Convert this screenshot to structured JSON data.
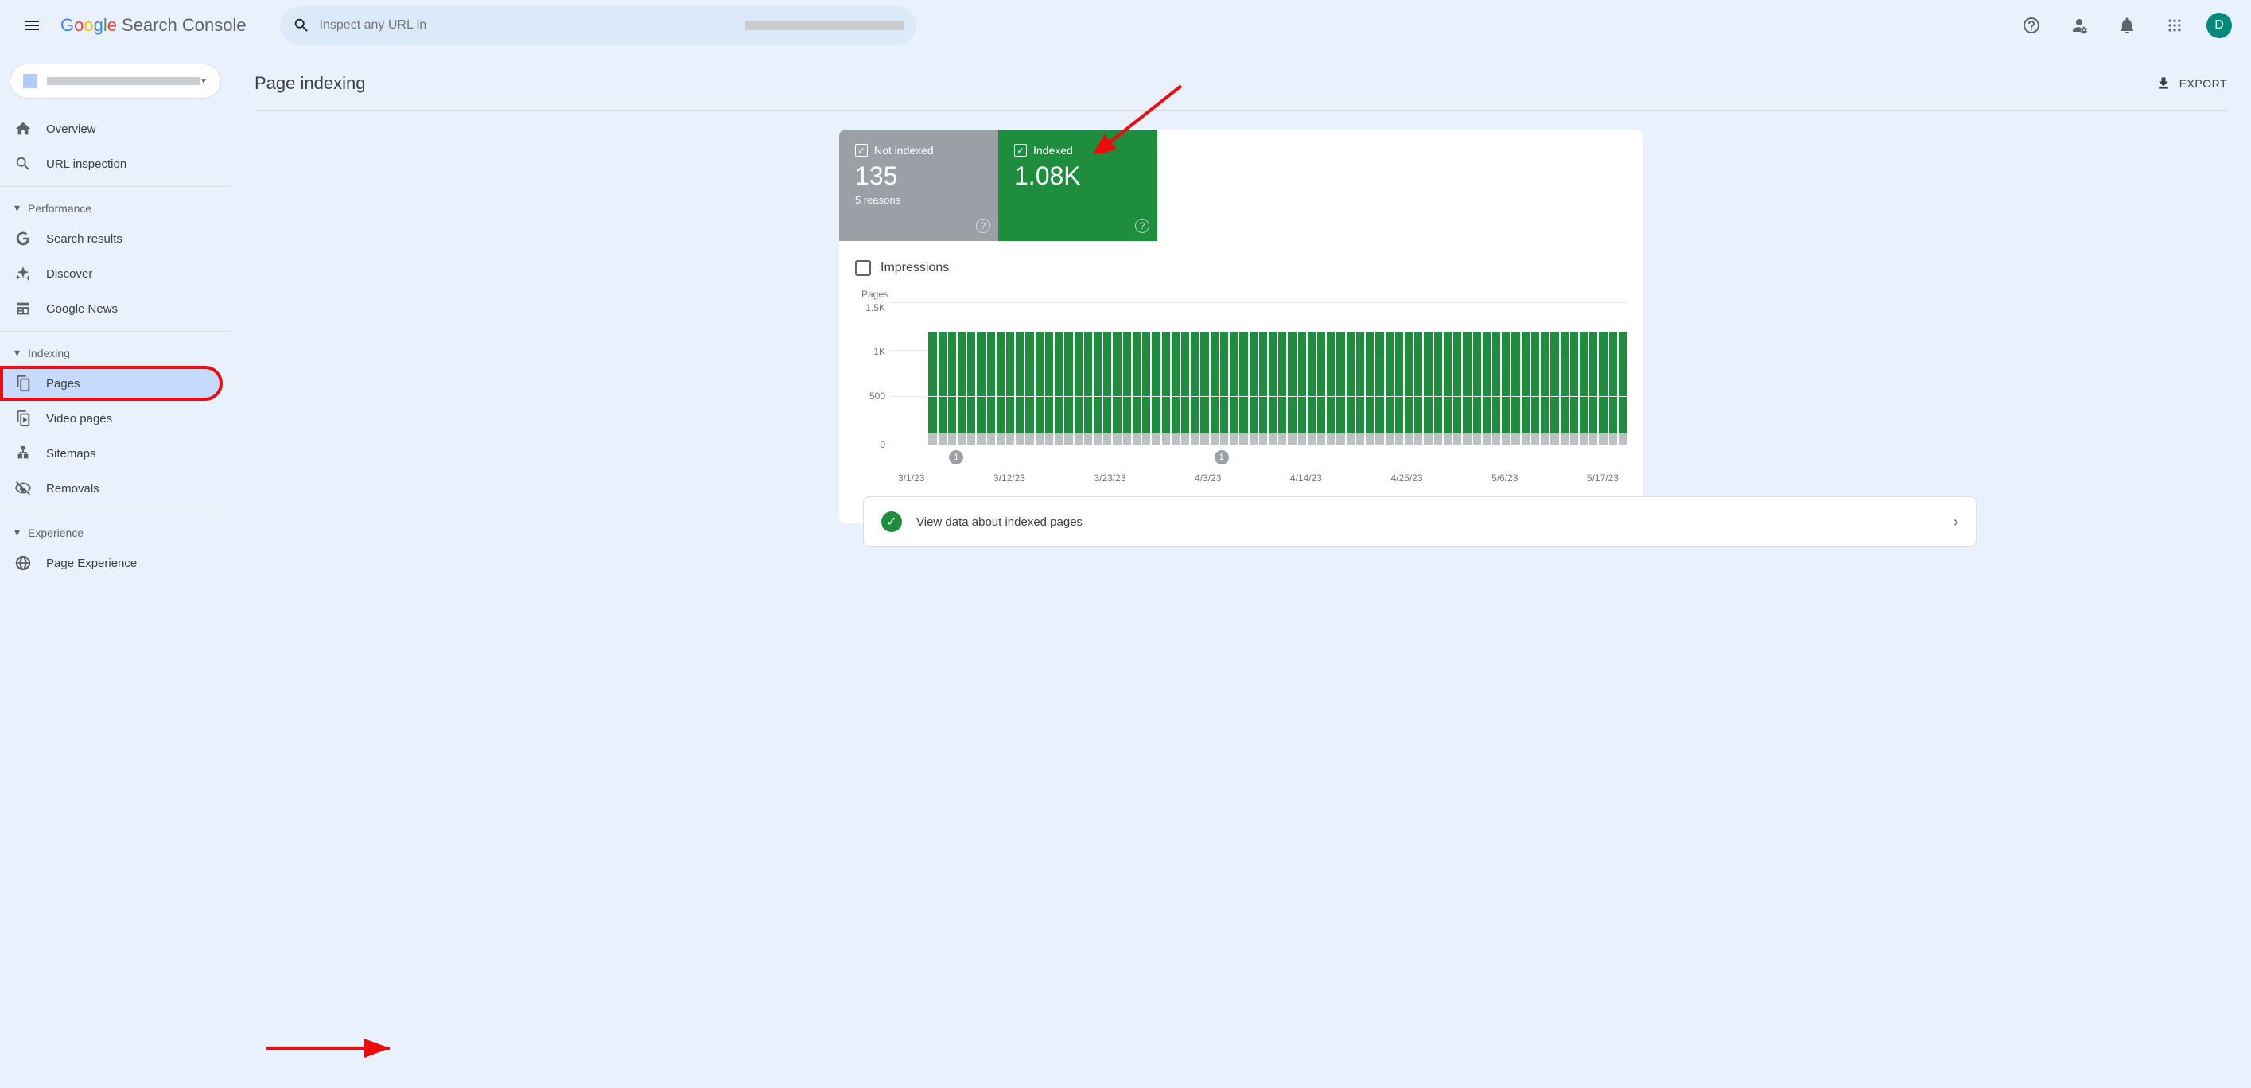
{
  "header": {
    "logo_suffix": "Search Console",
    "search_placeholder": "Inspect any URL in",
    "avatar_letter": "D"
  },
  "sidebar": {
    "overview": "Overview",
    "url_inspection": "URL inspection",
    "section_performance": "Performance",
    "search_results": "Search results",
    "discover": "Discover",
    "google_news": "Google News",
    "section_indexing": "Indexing",
    "pages": "Pages",
    "video_pages": "Video pages",
    "sitemaps": "Sitemaps",
    "removals": "Removals",
    "section_experience": "Experience",
    "page_experience": "Page Experience"
  },
  "page": {
    "title": "Page indexing",
    "export_label": "EXPORT"
  },
  "tabs": {
    "not_indexed_label": "Not indexed",
    "not_indexed_value": "135",
    "not_indexed_sub": "5 reasons",
    "indexed_label": "Indexed",
    "indexed_value": "1.08K"
  },
  "impressions_label": "Impressions",
  "chart_data": {
    "type": "bar",
    "ylabel": "Pages",
    "ylim": [
      0,
      1500
    ],
    "yticks": [
      "1.5K",
      "1K",
      "500",
      "0"
    ],
    "x_labels": [
      "3/1/23",
      "3/12/23",
      "3/23/23",
      "4/3/23",
      "4/14/23",
      "4/25/23",
      "5/6/23",
      "5/17/23"
    ],
    "series": [
      {
        "name": "Indexed",
        "value_approx": 1200
      },
      {
        "name": "Not indexed",
        "value_approx": 135
      }
    ],
    "markers": [
      "1",
      "1"
    ]
  },
  "link_row": {
    "text": "View data about indexed pages"
  }
}
